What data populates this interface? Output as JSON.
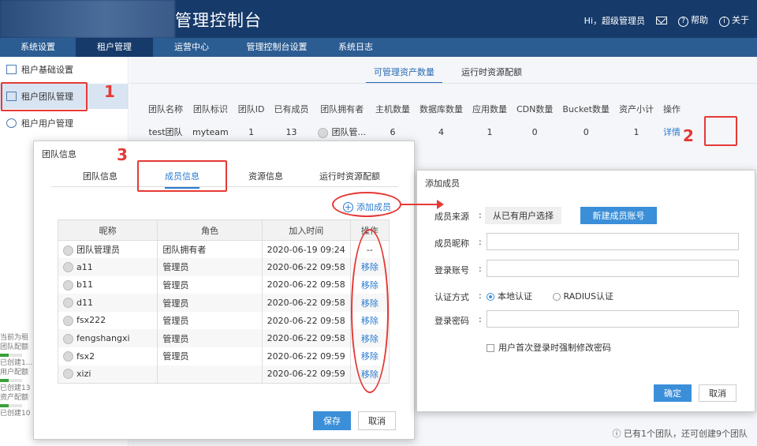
{
  "header": {
    "title": "管理控制台",
    "user": "Hi，超级管理员",
    "help": "帮助",
    "about": "关于"
  },
  "nav": [
    {
      "label": "系统设置"
    },
    {
      "label": "租户管理"
    },
    {
      "label": "运营中心"
    },
    {
      "label": "管理控制台设置"
    },
    {
      "label": "系统日志"
    }
  ],
  "sidebar": {
    "items": [
      {
        "label": "租户基础设置"
      },
      {
        "label": "租户团队管理"
      },
      {
        "label": "租户用户管理"
      }
    ],
    "bottom": [
      "当前为租",
      "团队配额",
      "已创建1...",
      "用户配额",
      "已创建13",
      "资产配额",
      "已创建10"
    ]
  },
  "main": {
    "tabs": [
      "可管理资产数量",
      "运行时资源配额"
    ],
    "columns": [
      "团队名称",
      "团队标识",
      "团队ID",
      "已有成员",
      "团队拥有者",
      "主机数量",
      "数据库数量",
      "应用数量",
      "CDN数量",
      "Bucket数量",
      "资产小计",
      "操作"
    ],
    "row": [
      "test团队",
      "myteam",
      "1",
      "13",
      "团队管...",
      "6",
      "4",
      "1",
      "0",
      "0",
      "1",
      "详情"
    ],
    "footnote": "ⓘ 已有1个团队，还可创建9个团队"
  },
  "team_modal": {
    "title": "团队信息",
    "tabs": [
      "团队信息",
      "成员信息",
      "资源信息",
      "运行时资源配额"
    ],
    "add_member": "添加成员",
    "columns": [
      "昵称",
      "角色",
      "加入时间",
      "操作"
    ],
    "members": [
      {
        "name": "团队管理员",
        "role": "团队拥有者",
        "time": "2020-06-19 09:24",
        "op": "--"
      },
      {
        "name": "a11",
        "role": "管理员",
        "time": "2020-06-22 09:58",
        "op": "移除"
      },
      {
        "name": "b11",
        "role": "管理员",
        "time": "2020-06-22 09:58",
        "op": "移除"
      },
      {
        "name": "d11",
        "role": "管理员",
        "time": "2020-06-22 09:58",
        "op": "移除"
      },
      {
        "name": "fsx222",
        "role": "管理员",
        "time": "2020-06-22 09:58",
        "op": "移除"
      },
      {
        "name": "fengshangxi",
        "role": "管理员",
        "time": "2020-06-22 09:58",
        "op": "移除"
      },
      {
        "name": "fsx2",
        "role": "管理员",
        "time": "2020-06-22 09:59",
        "op": "移除"
      },
      {
        "name": "xizi",
        "role": "",
        "time": "2020-06-22 09:59",
        "op": "移除"
      }
    ],
    "save": "保存",
    "cancel": "取消"
  },
  "add_modal": {
    "title": "添加成员",
    "source_label": "成员来源",
    "source_existing": "从已有用户选择",
    "source_new": "新建成员账号",
    "nickname_label": "成员昵称",
    "account_label": "登录账号",
    "auth_label": "认证方式",
    "auth_local": "本地认证",
    "auth_radius": "RADIUS认证",
    "password_label": "登录密码",
    "force_change": "用户首次登录时强制修改密码",
    "ok": "确定",
    "cancel": "取消"
  },
  "annotations": [
    "1",
    "2",
    "3"
  ]
}
